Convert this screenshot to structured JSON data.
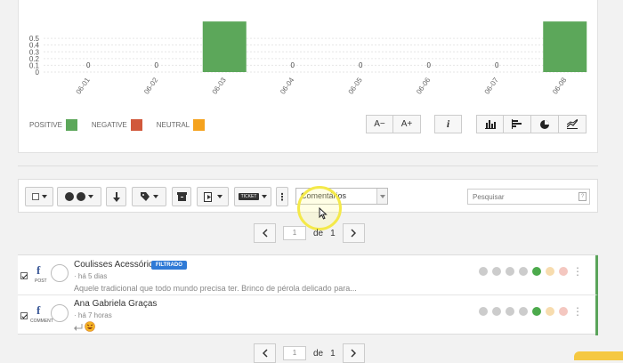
{
  "chart_data": {
    "type": "bar",
    "categories": [
      "06-01",
      "06-02",
      "06-03",
      "06-04",
      "06-05",
      "06-06",
      "06-07",
      "06-08"
    ],
    "y_ticks": [
      "0.5",
      "0.4",
      "0.3",
      "0.2",
      "0.1",
      "0"
    ],
    "series": [
      {
        "name": "POSITIVE",
        "color": "#5ca75a",
        "values": [
          0,
          0,
          1,
          0,
          0,
          0,
          0,
          1
        ]
      }
    ],
    "data_labels": [
      "0",
      "0",
      "",
      "0",
      "0",
      "0",
      "0",
      ""
    ],
    "ylim": [
      0,
      0.55
    ],
    "grid": true
  },
  "legend": {
    "items": [
      {
        "label": "POSITIVE",
        "color": "#5ca75a"
      },
      {
        "label": "NEGATIVE",
        "color": "#d1583b"
      },
      {
        "label": "NEUTRAL",
        "color": "#f5a21d"
      }
    ]
  },
  "chart_controls": {
    "font_smaller": "A−",
    "font_larger": "A+",
    "info": "i"
  },
  "toolbar": {
    "select_value": "Comentários",
    "search_placeholder": "Pesquisar",
    "search_help": "?",
    "ticket_label": "TICKET"
  },
  "pager": {
    "page": "1",
    "of_label": "de",
    "total": "1"
  },
  "posts": [
    {
      "type": "POST",
      "author": "Coulisses Acessórios",
      "badge": "FILTRADO",
      "time": "· há 5 dias",
      "snippet": "Aquele tradicional que todo mundo precisa ter. Brinco de pérola delicado para..."
    },
    {
      "type": "COMMENT",
      "author": "Ana Gabriela Graças",
      "time": "· há 7 horas",
      "snippet": ""
    }
  ]
}
